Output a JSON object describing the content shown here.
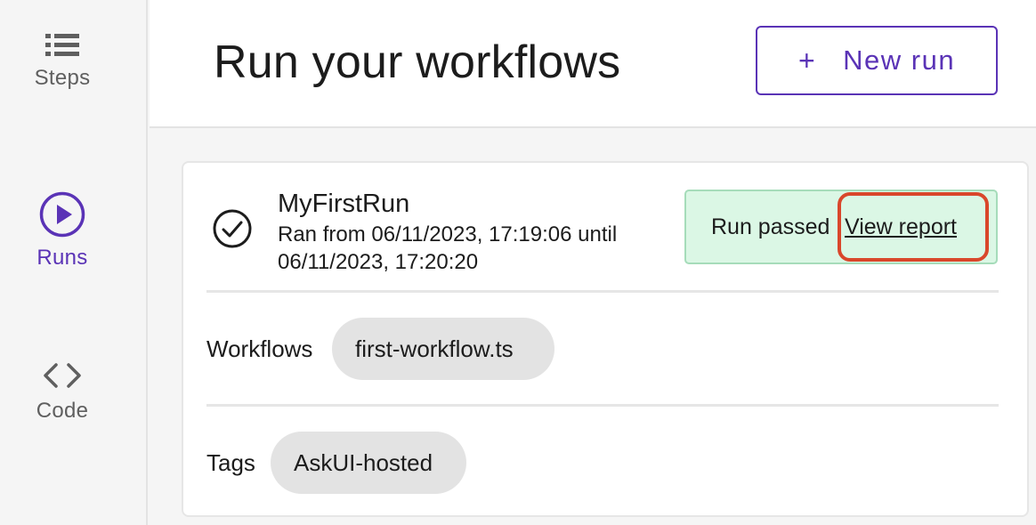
{
  "sidebar": {
    "items": [
      {
        "label": "Steps",
        "icon": "list-icon"
      },
      {
        "label": "Runs",
        "icon": "play-circle-icon",
        "active": true
      },
      {
        "label": "Code",
        "icon": "code-brackets-icon"
      }
    ]
  },
  "header": {
    "title": "Run your workflows",
    "new_run_plus": "+",
    "new_run_label": "New run"
  },
  "run": {
    "name": "MyFirstRun",
    "time_text": "Ran from 06/11/2023, 17:19:06 until 06/11/2023, 17:20:20",
    "status_text": "Run passed",
    "view_report_label": "View report",
    "workflows_label": "Workflows",
    "workflows": [
      "first-workflow.ts"
    ],
    "tags_label": "Tags",
    "tags": [
      "AskUI-hosted"
    ]
  },
  "colors": {
    "accent": "#5a33b6",
    "status_bg": "#dbf7e5",
    "status_border": "#a6dcba",
    "highlight": "#d9472b",
    "chip_bg": "#e3e3e3"
  }
}
